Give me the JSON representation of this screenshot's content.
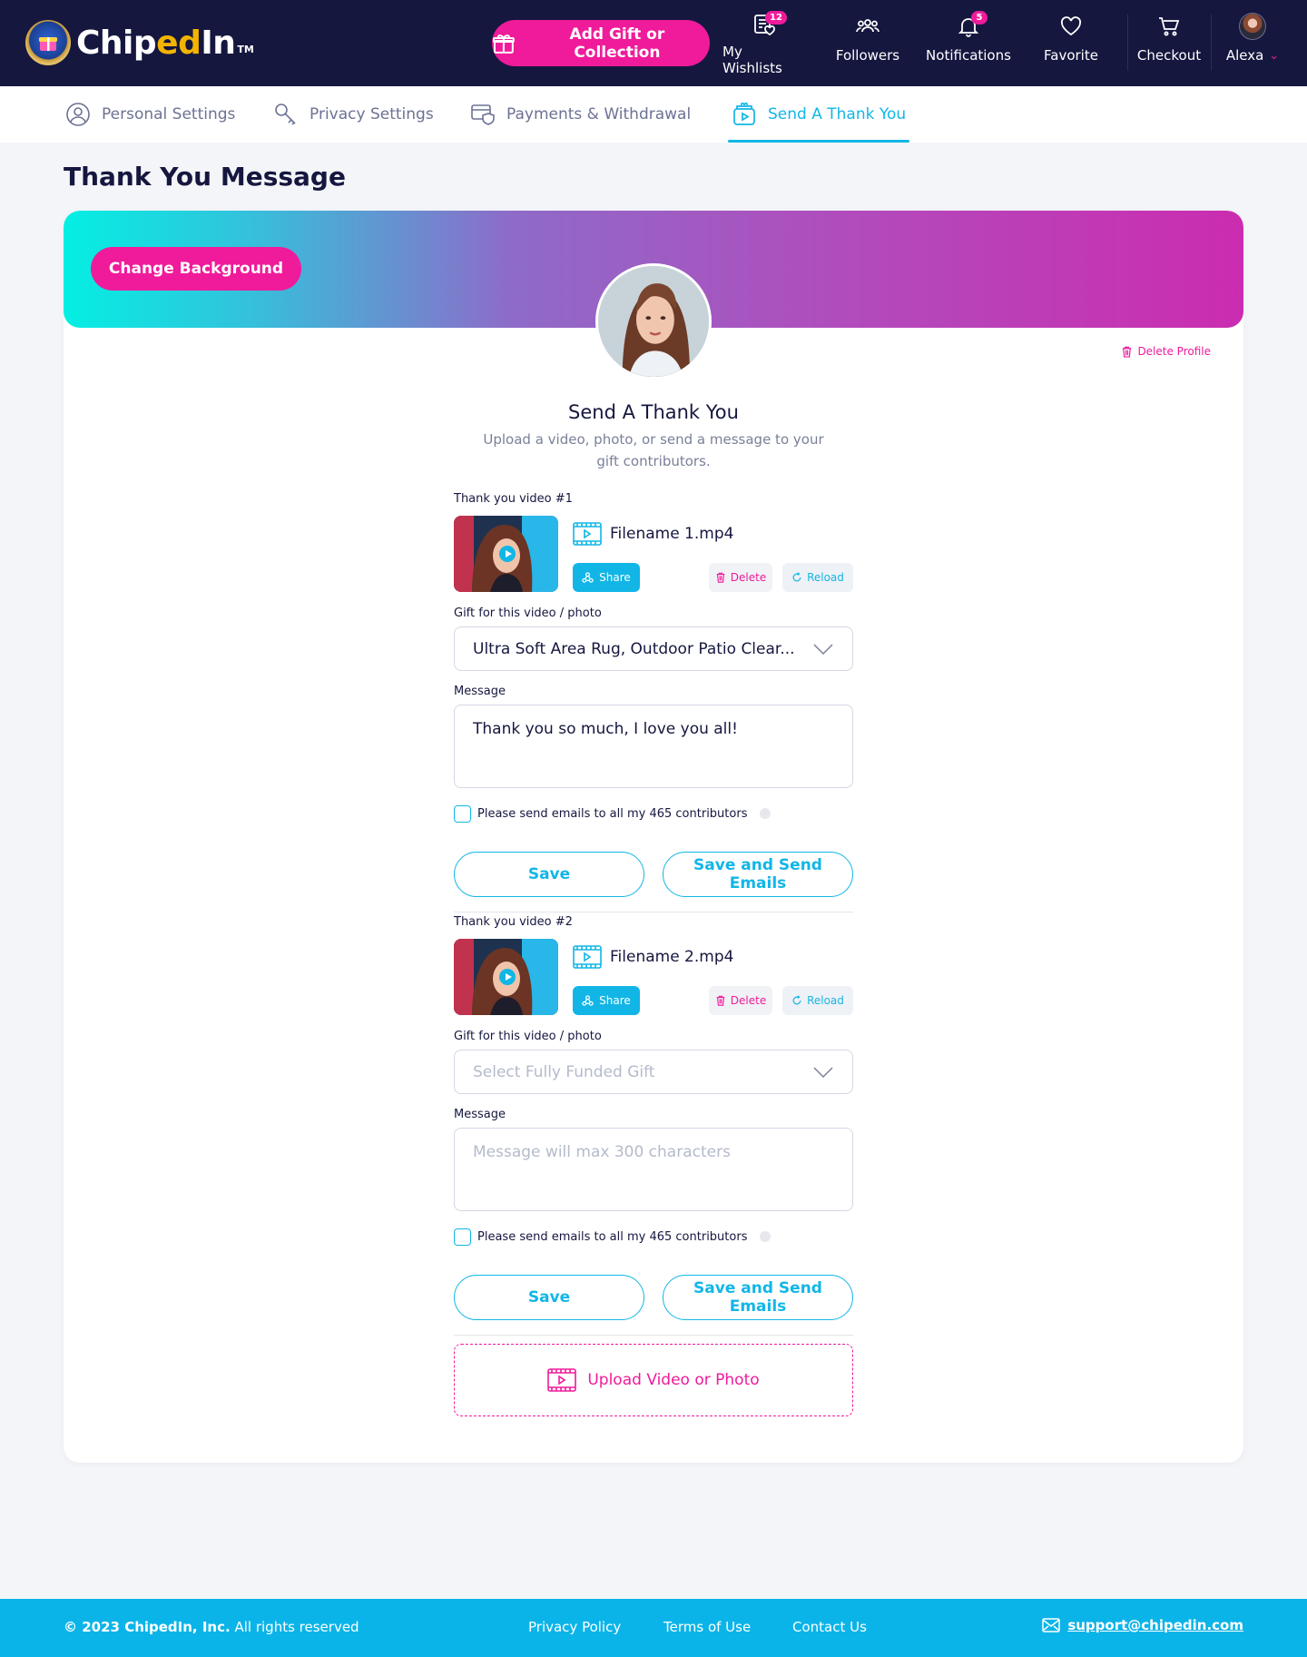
{
  "header": {
    "logo_text_a": "Chip",
    "logo_text_b": "ed",
    "logo_text_c": "In",
    "logo_tm": "TM",
    "add_gift_label": "Add Gift or Collection",
    "nav": [
      {
        "label": "My Wishlists",
        "icon": "wishlist-icon",
        "badge": "12"
      },
      {
        "label": "Followers",
        "icon": "followers-icon"
      },
      {
        "label": "Notifications",
        "icon": "bell-icon",
        "badge": "5"
      },
      {
        "label": "Favorite",
        "icon": "heart-icon"
      },
      {
        "label": "Checkout",
        "icon": "cart-icon"
      }
    ],
    "user_name": "Alexa"
  },
  "tabs": [
    {
      "label": "Personal Settings",
      "icon": "user-circle-icon",
      "active": false
    },
    {
      "label": "Privacy Settings",
      "icon": "key-icon",
      "active": false
    },
    {
      "label": "Payments & Withdrawal",
      "icon": "wallet-shield-icon",
      "active": false
    },
    {
      "label": "Send A Thank You",
      "icon": "video-gift-icon",
      "active": true
    }
  ],
  "page": {
    "title": "Thank You Message",
    "change_background_label": "Change Background",
    "delete_profile_label": "Delete Profile",
    "section_title": "Send A Thank You",
    "section_subtitle": "Upload a video, photo, or send a message to your gift contributors."
  },
  "videos": [
    {
      "label": "Thank you video #1",
      "filename": "Filename 1.mp4",
      "share_label": "Share",
      "delete_label": "Delete",
      "reload_label": "Reload",
      "gift_label": "Gift for this video / photo",
      "gift_value": "Ultra Soft Area Rug, Outdoor Patio Clear...",
      "gift_placeholder": "Select Fully Funded Gift",
      "message_label": "Message",
      "message_value": "Thank you so much, I love you all!",
      "message_placeholder": "Message will max 300 characters",
      "email_checkbox_label": "Please send emails to all my 465 contributors",
      "save_label": "Save",
      "save_send_label": "Save and Send Emails"
    },
    {
      "label": "Thank you video #2",
      "filename": "Filename 2.mp4",
      "share_label": "Share",
      "delete_label": "Delete",
      "reload_label": "Reload",
      "gift_label": "Gift for this video / photo",
      "gift_value": "",
      "gift_placeholder": "Select Fully Funded Gift",
      "message_label": "Message",
      "message_value": "",
      "message_placeholder": "Message will max 300 characters",
      "email_checkbox_label": "Please send emails to all my 465 contributors",
      "save_label": "Save",
      "save_send_label": "Save and Send Emails"
    }
  ],
  "upload_label": "Upload Video or Photo",
  "footer": {
    "copyright_bold": "© 2023 ChipedIn, Inc.",
    "copyright_rest": " All rights reserved",
    "links": [
      "Privacy Policy",
      "Terms of Use",
      "Contact Us"
    ],
    "email": "support@chipedin.com"
  },
  "colors": {
    "brand_navy": "#15173f",
    "brand_pink": "#ef1b9a",
    "brand_cyan": "#12b6e6",
    "logo_yellow": "#f3b400"
  }
}
